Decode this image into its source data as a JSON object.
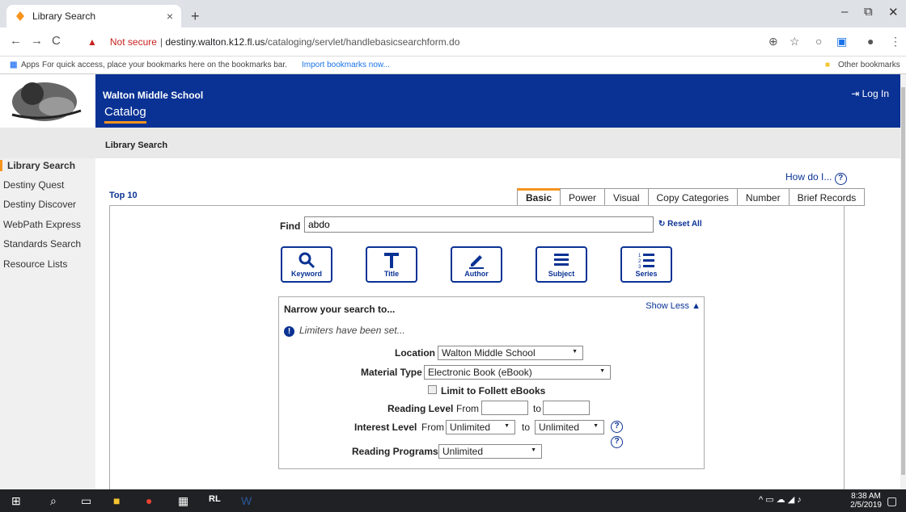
{
  "browser": {
    "tab_title": "Library Search",
    "new_tab": "+",
    "tab_close": "×",
    "url_warning": "Not secure",
    "url_domain": "destiny.walton.k12.fl.us",
    "url_path": "/cataloging/servlet/handlebasicsearchform.do"
  },
  "bookmarks": {
    "apps": "Apps",
    "message": "For quick access, place your bookmarks here on the bookmarks bar.",
    "import": "Import bookmarks now...",
    "other": "Other bookmarks"
  },
  "header": {
    "school": "Walton Middle School",
    "catalog": "Catalog",
    "login": "Log In"
  },
  "breadcrumb": "Library Search",
  "sidebar": {
    "items": [
      {
        "label": "Library Search"
      },
      {
        "label": "Destiny Quest"
      },
      {
        "label": "Destiny Discover"
      },
      {
        "label": "WebPath Express"
      },
      {
        "label": "Standards Search"
      },
      {
        "label": "Resource Lists"
      }
    ]
  },
  "main": {
    "how_do_i": "How do I...",
    "top10": "Top 10",
    "tabs": [
      {
        "label": "Basic"
      },
      {
        "label": "Power"
      },
      {
        "label": "Visual"
      },
      {
        "label": "Copy Categories"
      },
      {
        "label": "Number"
      },
      {
        "label": "Brief Records"
      }
    ],
    "find_label": "Find",
    "find_value": "abdo",
    "reset": "Reset All",
    "buttons": [
      {
        "label": "Keyword"
      },
      {
        "label": "Title"
      },
      {
        "label": "Author"
      },
      {
        "label": "Subject"
      },
      {
        "label": "Series"
      }
    ],
    "narrow": {
      "title": "Narrow your search to...",
      "show_less": "Show Less",
      "limiters": "Limiters have been set...",
      "location_label": "Location",
      "location_value": "Walton Middle School",
      "material_label": "Material Type",
      "material_value": "Electronic Book (eBook)",
      "follett": "Limit to Follett eBooks",
      "reading_label": "Reading Level",
      "from": "From",
      "to": "to",
      "interest_label": "Interest Level",
      "interest_from": "Unlimited",
      "interest_to": "Unlimited",
      "programs_label": "Reading Programs",
      "programs_value": "Unlimited"
    }
  },
  "taskbar": {
    "time": "8:38 AM",
    "date": "2/5/2019"
  }
}
